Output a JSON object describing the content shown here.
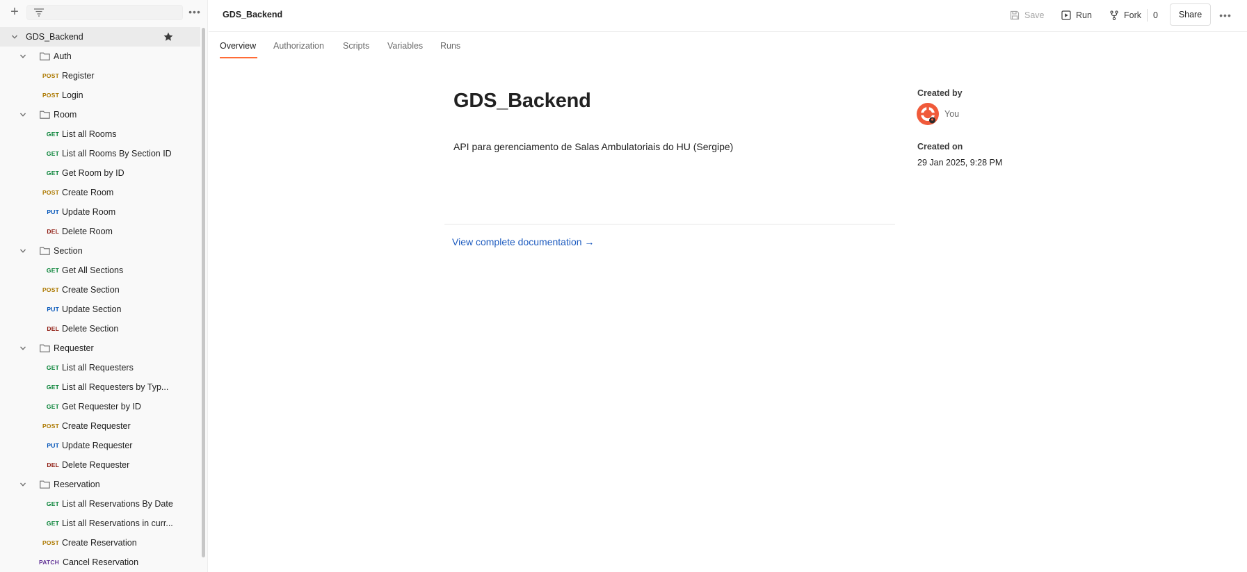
{
  "header": {
    "title": "GDS_Backend",
    "save_label": "Save",
    "run_label": "Run",
    "fork_label": "Fork",
    "fork_count": "0",
    "share_label": "Share",
    "more_label": "•••"
  },
  "sidebar": {
    "more_label": "•••",
    "collection": "GDS_Backend",
    "folders": [
      {
        "name": "Auth",
        "requests": [
          {
            "method": "POST",
            "name": "Register"
          },
          {
            "method": "POST",
            "name": "Login"
          }
        ]
      },
      {
        "name": "Room",
        "requests": [
          {
            "method": "GET",
            "name": "List all Rooms"
          },
          {
            "method": "GET",
            "name": "List all Rooms By Section ID"
          },
          {
            "method": "GET",
            "name": "Get Room by ID"
          },
          {
            "method": "POST",
            "name": "Create Room"
          },
          {
            "method": "PUT",
            "name": "Update Room"
          },
          {
            "method": "DEL",
            "name": "Delete Room"
          }
        ]
      },
      {
        "name": "Section",
        "requests": [
          {
            "method": "GET",
            "name": "Get All Sections"
          },
          {
            "method": "POST",
            "name": "Create Section"
          },
          {
            "method": "PUT",
            "name": "Update Section"
          },
          {
            "method": "DEL",
            "name": "Delete Section"
          }
        ]
      },
      {
        "name": "Requester",
        "requests": [
          {
            "method": "GET",
            "name": "List all Requesters"
          },
          {
            "method": "GET",
            "name": "List all Requesters by Typ..."
          },
          {
            "method": "GET",
            "name": "Get Requester by ID"
          },
          {
            "method": "POST",
            "name": "Create Requester"
          },
          {
            "method": "PUT",
            "name": "Update Requester"
          },
          {
            "method": "DEL",
            "name": "Delete Requester"
          }
        ]
      },
      {
        "name": "Reservation",
        "requests": [
          {
            "method": "GET",
            "name": "List all Reservations By Date"
          },
          {
            "method": "GET",
            "name": "List all Reservations in curr..."
          },
          {
            "method": "POST",
            "name": "Create Reservation"
          },
          {
            "method": "PATCH",
            "name": "Cancel Reservation"
          }
        ]
      }
    ]
  },
  "tabs": [
    {
      "label": "Overview",
      "active": true
    },
    {
      "label": "Authorization",
      "active": false
    },
    {
      "label": "Scripts",
      "active": false
    },
    {
      "label": "Variables",
      "active": false
    },
    {
      "label": "Runs",
      "active": false
    }
  ],
  "overview": {
    "title": "GDS_Backend",
    "description": "API para gerenciamento de Salas Ambulatoriais do HU (Sergipe)",
    "doc_link": "View complete documentation →",
    "created_by_label": "Created by",
    "created_by_value": "You",
    "created_on_label": "Created on",
    "created_on_value": "29 Jan 2025, 9:28 PM"
  },
  "colors": {
    "accent": "#ff6c37",
    "get": "#007f31",
    "post": "#ad7a03",
    "put": "#0053b8",
    "del": "#8e1a10",
    "patch": "#623497",
    "link": "#1d5bbf"
  }
}
